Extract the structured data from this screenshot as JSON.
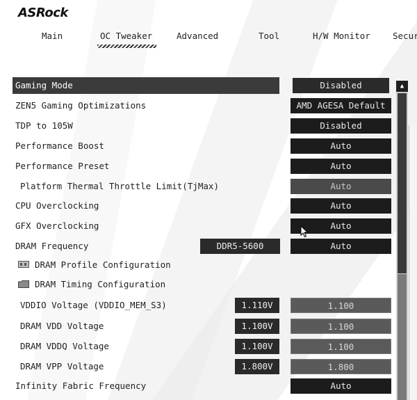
{
  "brand": {
    "logo": "ASRock"
  },
  "tabs": [
    "Main",
    "OC Tweaker",
    "Advanced",
    "Tool",
    "H/W Monitor",
    "Secur"
  ],
  "active_tab": "OC Tweaker",
  "settings": [
    {
      "label": "Gaming Mode",
      "value": "Disabled"
    },
    {
      "label": "ZEN5 Gaming Optimizations",
      "value": "AMD AGESA Default"
    },
    {
      "label": "TDP to 105W",
      "value": "Disabled"
    },
    {
      "label": "Performance Boost",
      "value": "Auto"
    },
    {
      "label": "Performance Preset",
      "value": "Auto"
    },
    {
      "label": "Platform Thermal Throttle Limit(TjMax)",
      "value": "Auto"
    },
    {
      "label": "CPU Overclocking",
      "value": "Auto"
    },
    {
      "label": "GFX Overclocking",
      "value": "Auto"
    },
    {
      "label": "DRAM Frequency",
      "value": "Auto",
      "readout": "DDR5-5600"
    },
    {
      "label": "DRAM Profile Configuration"
    },
    {
      "label": "DRAM Timing Configuration"
    },
    {
      "label": "VDDIO Voltage (VDDIO_MEM_S3)",
      "value": "1.100",
      "readout": "1.110V"
    },
    {
      "label": "DRAM VDD Voltage",
      "value": "1.100",
      "readout": "1.100V"
    },
    {
      "label": "DRAM VDDQ Voltage",
      "value": "1.100",
      "readout": "1.100V"
    },
    {
      "label": "DRAM VPP Voltage",
      "value": "1.800",
      "readout": "1.800V"
    },
    {
      "label": "Infinity Fabric Frequency",
      "value": "Auto"
    }
  ],
  "icons": {
    "scroll_up": "up-arrow-icon",
    "folder": "folder-icon",
    "cursor": "mouse-cursor-icon"
  }
}
